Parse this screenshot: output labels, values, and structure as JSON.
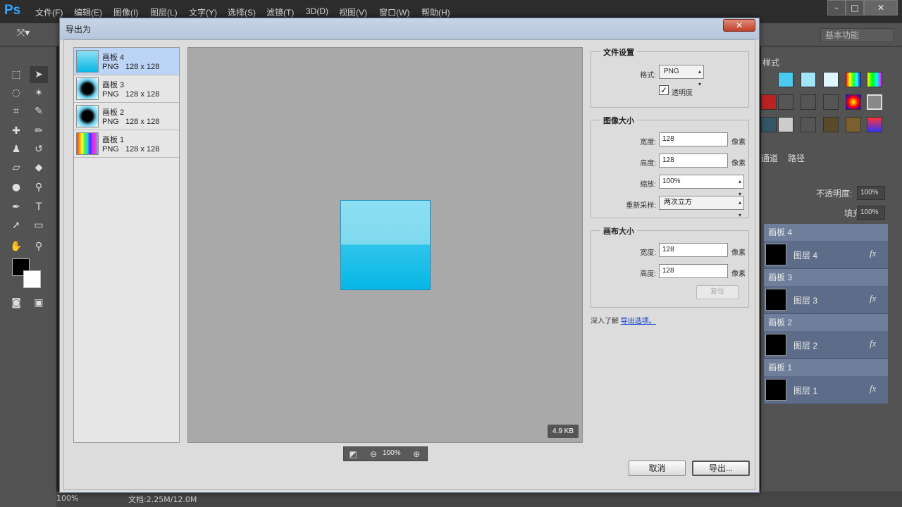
{
  "app": {
    "logo": "Ps",
    "menu": [
      "文件(F)",
      "编辑(E)",
      "图像(I)",
      "图层(L)",
      "文字(Y)",
      "选择(S)",
      "滤镜(T)",
      "3D(D)",
      "视图(V)",
      "窗口(W)",
      "帮助(H)"
    ],
    "workspace": "基本功能",
    "panel_tabs": {
      "styles": "样式",
      "channels": "通道",
      "paths": "路径"
    },
    "opacity_label": "不透明度:",
    "opacity_value": "100%",
    "fill_label": "填充:",
    "fill_value": "100%",
    "layers": [
      {
        "group": "画板 4",
        "layer": "图层 4"
      },
      {
        "group": "画板 3",
        "layer": "图层 3"
      },
      {
        "group": "画板 2",
        "layer": "图层 2"
      },
      {
        "group": "画板 1",
        "layer": "图层 1"
      }
    ],
    "status": {
      "zoom": "100%",
      "doc": "文档:2.25M/12.0M"
    }
  },
  "dialog": {
    "title": "导出为",
    "close_label": "✕",
    "artboards": [
      {
        "name": "画板 4",
        "format": "PNG",
        "size": "128 x 128",
        "thumb": "gradient-blue"
      },
      {
        "name": "画板 3",
        "format": "PNG",
        "size": "128 x 128",
        "thumb": "black-square-blue-glow"
      },
      {
        "name": "画板 2",
        "format": "PNG",
        "size": "128 x 128",
        "thumb": "black-square-blue-glow"
      },
      {
        "name": "画板 1",
        "format": "PNG",
        "size": "128 x 128",
        "thumb": "rainbow-stripes"
      }
    ],
    "preview": {
      "file_size": "4.9 KB",
      "zoom": "100%"
    },
    "file_settings": {
      "title": "文件设置",
      "format_label": "格式:",
      "format_value": "PNG",
      "transparency_label": "透明度",
      "transparency_checked": true
    },
    "image_size": {
      "title": "图像大小",
      "width_label": "宽度:",
      "width_value": "128",
      "height_label": "高度:",
      "height_value": "128",
      "scale_label": "缩放:",
      "scale_value": "100%",
      "resample_label": "重新采样:",
      "resample_value": "两次立方",
      "unit": "像素"
    },
    "canvas_size": {
      "title": "画布大小",
      "width_label": "宽度:",
      "width_value": "128",
      "height_label": "高度:",
      "height_value": "128",
      "unit": "像素",
      "reset_label": "复位"
    },
    "learn_more_prefix": "深入了解",
    "learn_more_link": "导出选项。",
    "cancel_label": "取消",
    "export_label": "导出..."
  },
  "colors": {
    "accent_selected": "#bcd4f6",
    "preview_bg": "#a9a9a9",
    "layers_panel": "#5c6c89"
  }
}
